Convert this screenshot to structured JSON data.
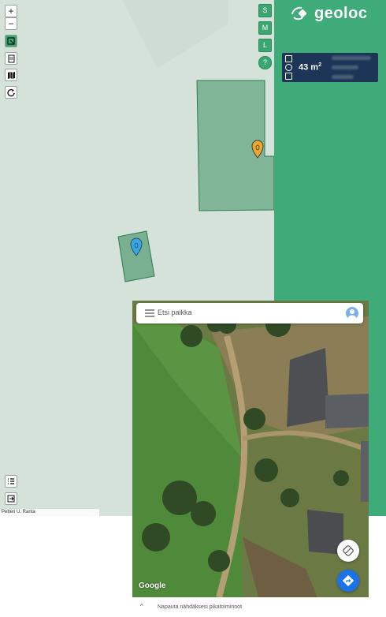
{
  "map": {
    "zoom_in": "+",
    "zoom_out": "−",
    "size_buttons": [
      "S",
      "M",
      "L"
    ],
    "help": "?",
    "attribution": "Petteri U. Ranta",
    "marker_colors": {
      "orange": "#f0a92d",
      "blue": "#39a7e6"
    },
    "field_color": "#3c8f62"
  },
  "panel": {
    "brand": "geoloc",
    "area_value": "43 m",
    "area_unit": "2",
    "accent": "#3fab78",
    "card_bg": "#1d3557"
  },
  "gmaps": {
    "search_placeholder": "Etsi paikka",
    "google_label": "Google",
    "bottom_hint": "Napauta nähdäksesi pikatoiminnot",
    "chevron": "^"
  }
}
